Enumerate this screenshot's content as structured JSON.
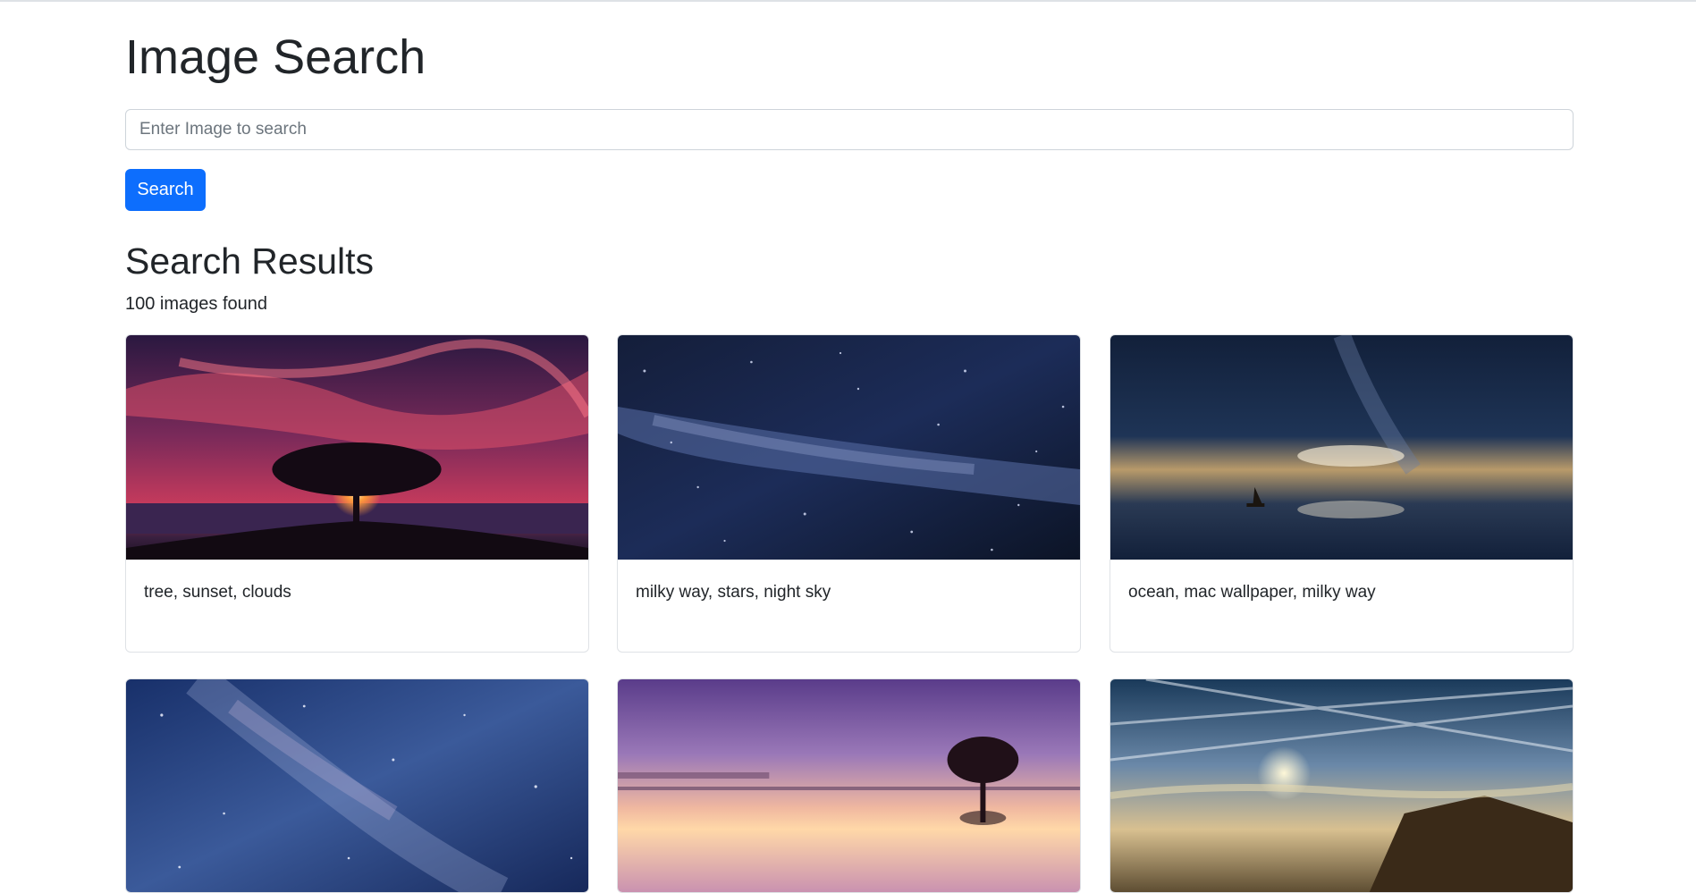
{
  "page": {
    "title": "Image Search",
    "search": {
      "placeholder": "Enter Image to search",
      "value": ""
    },
    "search_button_label": "Search",
    "results_heading": "Search Results",
    "results_count": "100 images found"
  },
  "results": [
    {
      "tags": "tree, sunset, clouds",
      "scene": "tree-sunset"
    },
    {
      "tags": "milky way, stars, night sky",
      "scene": "milky-way"
    },
    {
      "tags": "ocean, mac wallpaper, milky way",
      "scene": "ocean-boat"
    },
    {
      "tags": "",
      "scene": "galaxy"
    },
    {
      "tags": "",
      "scene": "lake-tree"
    },
    {
      "tags": "",
      "scene": "coast-sunset"
    }
  ],
  "colors": {
    "accent": "#0d6efd",
    "text": "#212529",
    "muted": "#6c757d"
  }
}
